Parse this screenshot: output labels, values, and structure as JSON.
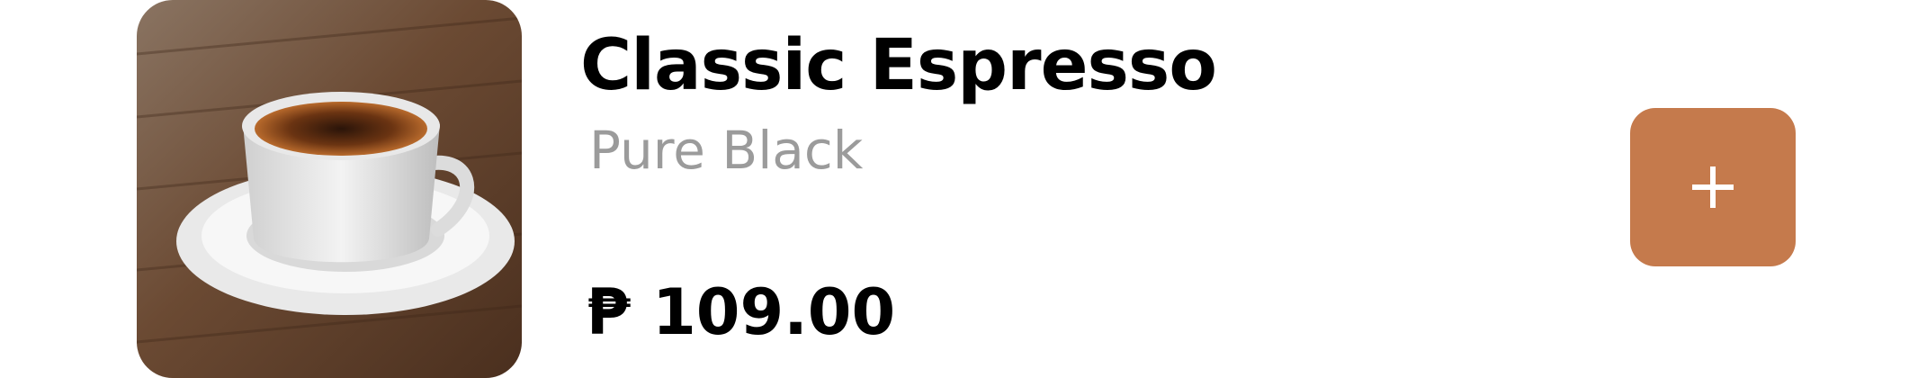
{
  "product": {
    "title": "Classic Espresso",
    "subtitle": "Pure Black",
    "price": "₱ 109.00",
    "image_icon": "espresso-cup-photo"
  },
  "actions": {
    "add_icon": "plus-icon"
  },
  "colors": {
    "accent": "#c57a4c",
    "title": "#000000",
    "subtitle": "#9b9b9b",
    "background": "#ffffff"
  }
}
